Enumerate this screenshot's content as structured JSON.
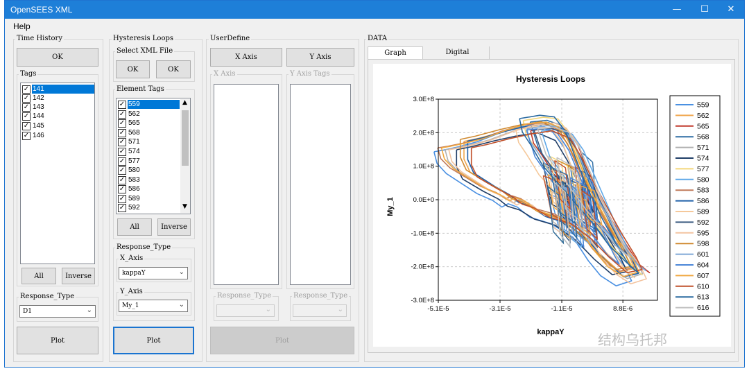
{
  "window": {
    "title": "OpenSEES XML",
    "minimize": "—",
    "maximize": "☐",
    "close": "✕"
  },
  "menu": {
    "help": "Help"
  },
  "time_history": {
    "label": "Time History",
    "ok": "OK",
    "tags_label": "Tags",
    "tags": [
      "141",
      "142",
      "143",
      "144",
      "145",
      "146"
    ],
    "all": "All",
    "inverse": "Inverse",
    "response_type_label": "Response_Type",
    "response_type_value": "D1",
    "plot": "Plot"
  },
  "hysteresis": {
    "label": "Hysteresis Loops",
    "select_xml_label": "Select XML File",
    "ok1": "OK",
    "ok2": "OK",
    "element_tags_label": "Element Tags",
    "element_tags": [
      "559",
      "562",
      "565",
      "568",
      "571",
      "574",
      "577",
      "580",
      "583",
      "586",
      "589",
      "592"
    ],
    "all": "All",
    "inverse": "Inverse",
    "response_type_label": "Response_Type",
    "x_axis_label": "X_Axis",
    "x_axis_value": "kappaY",
    "y_axis_label": "Y_Axis",
    "y_axis_value": "My_1",
    "plot": "Plot"
  },
  "userdefine": {
    "label": "UserDefine",
    "x_axis_button": "X Axis",
    "y_axis_button": "Y Axis",
    "x_axis_list_label": "X Axis",
    "y_axis_list_label": "Y Axis Tags",
    "response_type_label_1": "Response_Type",
    "response_type_label_2": "Response_Type",
    "plot": "Plot"
  },
  "data": {
    "label": "DATA",
    "tab_graph": "Graph",
    "tab_digital": "Digital"
  },
  "chart_data": {
    "type": "line",
    "title": "Hysteresis Loops",
    "xlabel": "kappaY",
    "ylabel": "My_1",
    "xlim": [
      -5.1e-05,
      2e-05
    ],
    "ylim": [
      -300000000,
      300000000
    ],
    "xticks": [
      "-5.1E-5",
      "-3.1E-5",
      "-1.1E-5",
      "8.8E-6"
    ],
    "yticks": [
      "3.0E+8",
      "2.0E+8",
      "1.0E+8",
      "0.0E+0",
      "-1.0E+8",
      "-2.0E+8",
      "-3.0E+8"
    ],
    "grid": true,
    "legend_placement": "right",
    "series": [
      {
        "name": "559",
        "color": "#4a90e2"
      },
      {
        "name": "562",
        "color": "#f0a850"
      },
      {
        "name": "565",
        "color": "#c0392b"
      },
      {
        "name": "568",
        "color": "#2e6da4"
      },
      {
        "name": "571",
        "color": "#b0b0b0"
      },
      {
        "name": "574",
        "color": "#1f3d66"
      },
      {
        "name": "577",
        "color": "#f4d77a"
      },
      {
        "name": "580",
        "color": "#5fa8e8"
      },
      {
        "name": "583",
        "color": "#c07a5a"
      },
      {
        "name": "586",
        "color": "#1e5fa8"
      },
      {
        "name": "589",
        "color": "#f5c89a"
      },
      {
        "name": "592",
        "color": "#3a5a80"
      },
      {
        "name": "595",
        "color": "#f3c4a0"
      },
      {
        "name": "598",
        "color": "#d08a30"
      },
      {
        "name": "601",
        "color": "#7fa8d6"
      },
      {
        "name": "604",
        "color": "#4a86d8"
      },
      {
        "name": "607",
        "color": "#f0a840"
      },
      {
        "name": "610",
        "color": "#c0502a"
      },
      {
        "name": "613",
        "color": "#2a6aa0"
      },
      {
        "name": "616",
        "color": "#c0c0c0"
      }
    ]
  },
  "watermark": "结构乌托邦"
}
